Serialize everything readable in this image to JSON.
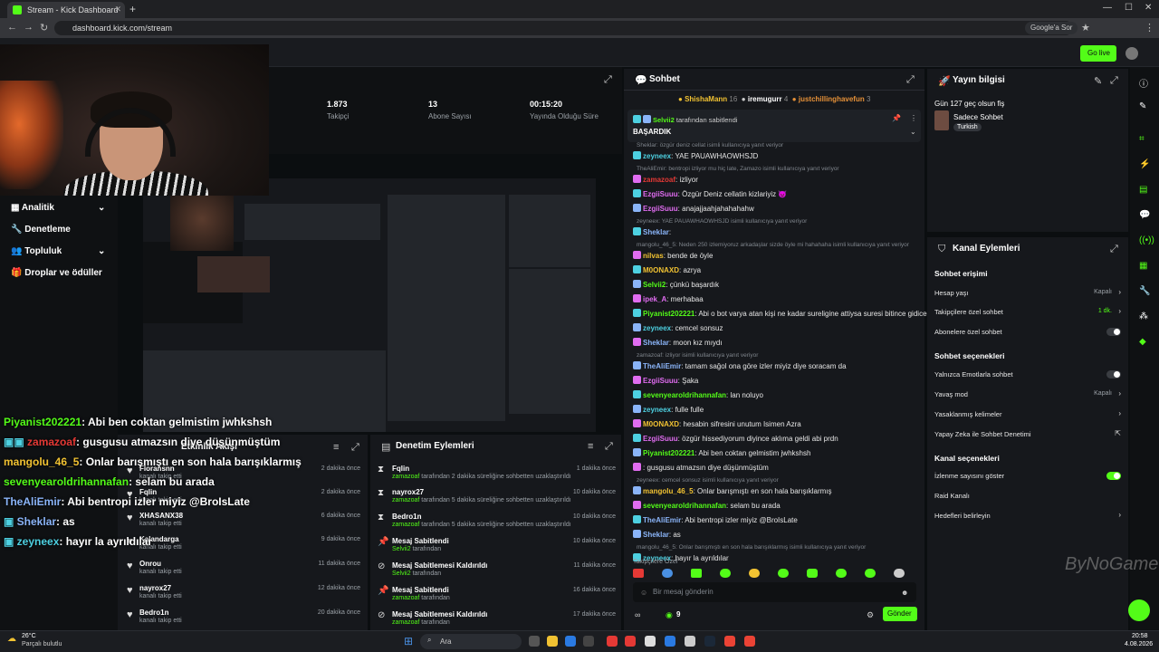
{
  "browser": {
    "tab_title": "Stream - Kick Dashboard",
    "url": "dashboard.kick.com/stream",
    "google_sor": "Google'a Sor"
  },
  "header": {
    "go_live": "Go live"
  },
  "sidebar": {
    "items": [
      {
        "label": "Analitik",
        "icon": "chart-icon"
      },
      {
        "label": "Denetleme",
        "icon": "wrench-icon"
      },
      {
        "label": "Topluluk",
        "icon": "users-icon"
      },
      {
        "label": "Droplar ve ödüller",
        "icon": "gift-icon"
      }
    ]
  },
  "stats": [
    {
      "value": "1.873",
      "label": "Takipçi"
    },
    {
      "value": "13",
      "label": "Abone Sayısı"
    },
    {
      "value": "00:15:20",
      "label": "Yayında Olduğu Süre"
    }
  ],
  "overlay_chat": [
    {
      "user": "Piyanist202221",
      "msg": ": Abi ben coktan gelmistim jwhkshsh",
      "color": "#53fc18"
    },
    {
      "user": "zamazoaf",
      "msg": ": gusgusu atmazsın diye düşünmüştüm",
      "color": "#e53935"
    },
    {
      "user": "mangolu_46_5",
      "msg": ": Onlar barışmıştı en son hala barışıklarmış",
      "color": "#f1c232"
    },
    {
      "user": "sevenyearoldrihannafan",
      "msg": ": selam bu arada",
      "color": "#53fc18"
    },
    {
      "user": "TheAliEmir",
      "msg": ": Abi bentropi izler miyiz @BroIsLate",
      "color": "#8ab4f8"
    },
    {
      "user": "Sheklar",
      "msg": ": as",
      "color": "#8ab4f8"
    },
    {
      "user": "zeyneex",
      "msg": ": hayır la ayrıldılar",
      "color": "#4dd0e1"
    }
  ],
  "followers": {
    "title": "Etkinlik Akışı",
    "items": [
      {
        "name": "Floransnn",
        "sub": "kanalı takip etti",
        "time": "2 dakika önce"
      },
      {
        "name": "Fqlin",
        "sub": "kanalı takip etti",
        "time": "2 dakika önce"
      },
      {
        "name": "XHASANX38",
        "sub": "kanalı takip etti",
        "time": "6 dakika önce"
      },
      {
        "name": "Kalandarga",
        "sub": "kanalı takip etti",
        "time": "9 dakika önce"
      },
      {
        "name": "Onrou",
        "sub": "kanalı takip etti",
        "time": "11 dakika önce"
      },
      {
        "name": "nayrox27",
        "sub": "kanalı takip etti",
        "time": "12 dakika önce"
      },
      {
        "name": "Bedro1n",
        "sub": "kanalı takip etti",
        "time": "20 dakika önce"
      }
    ]
  },
  "moderation": {
    "title": "Denetim Eylemleri",
    "items": [
      {
        "name": "Fqlin",
        "by": "zamazoaf",
        "sub": " tarafından 2 dakika süreliğine sohbetten uzaklaştırıldı",
        "time": "1 dakika önce",
        "icon": "hourglass-icon"
      },
      {
        "name": "nayrox27",
        "by": "zamazoaf",
        "sub": " tarafından 5 dakika süreliğine sohbetten uzaklaştırıldı",
        "time": "10 dakika önce",
        "icon": "hourglass-icon"
      },
      {
        "name": "Bedro1n",
        "by": "zamazoaf",
        "sub": " tarafından 5 dakika süreliğine sohbetten uzaklaştırıldı",
        "time": "10 dakika önce",
        "icon": "hourglass-icon"
      },
      {
        "name": "Mesaj Sabitlendi",
        "by": "Selvii2",
        "sub": " tarafından",
        "time": "10 dakika önce",
        "icon": "pin-icon"
      },
      {
        "name": "Mesaj Sabitlemesi Kaldırıldı",
        "by": "Selvii2",
        "sub": " tarafından",
        "time": "11 dakika önce",
        "icon": "unpin-icon"
      },
      {
        "name": "Mesaj Sabitlendi",
        "by": "zamazoaf",
        "sub": " tarafından",
        "time": "16 dakika önce",
        "icon": "pin-icon"
      },
      {
        "name": "Mesaj Sabitlemesi Kaldırıldı",
        "by": "zamazoaf",
        "sub": " tarafından",
        "time": "17 dakika önce",
        "icon": "unpin-icon"
      }
    ]
  },
  "chat": {
    "title": "Sohbet",
    "top_gifters": [
      {
        "name": "ShishaMann",
        "count": "16"
      },
      {
        "name": "iremugurr",
        "count": "4"
      },
      {
        "name": "justchillinghavefun",
        "count": "3"
      }
    ],
    "pinned_by": "Selvii2",
    "pinned_by_suffix": " tarafından sabitlendi",
    "pinned_msg": "BAŞARDIK",
    "messages": [
      {
        "reply": "Sheklar: özgür deniz cellat isimli kullanıcıya yanıt veriyor"
      },
      {
        "user": "zeyneex",
        "color": "#4dd0e1",
        "text": ": YAE PAUAWHAOWHSJD"
      },
      {
        "reply": "TheAliEmir: bentropi izliyor mu hiç late, Zamazo isimli kullanıcıya yanıt veriyor"
      },
      {
        "user": "zamazoaf",
        "color": "#e53935",
        "text": ": izliyor"
      },
      {
        "user": "EzgiiSuuu",
        "color": "#e06cf0",
        "text": ": Özgür Deniz cellatin kizlariyiz 😈"
      },
      {
        "user": "EzgiiSuuu",
        "color": "#e06cf0",
        "text": ": anajajjaahjahahahahw"
      },
      {
        "reply": "zeyneex: YAE PAUAWHAOWHSJD isimli kullanıcıya yanıt veriyor"
      },
      {
        "user": "Sheklar",
        "color": "#8ab4f8",
        "text": ":"
      },
      {
        "reply": "mangolu_46_5: Neden 250 izlemiyoruz arkadaşlar sizde öyle mi hahahaha isimli kullanıcıya yanıt veriyor"
      },
      {
        "user": "nilvas",
        "color": "#f1c232",
        "text": ": bende de öyle"
      },
      {
        "user": "M0ONAXD",
        "color": "#f1c232",
        "text": ": azrya"
      },
      {
        "user": "Selvii2",
        "color": "#53fc18",
        "text": ": çünkü başardık"
      },
      {
        "user": "ipek_A",
        "color": "#e06cf0",
        "text": ": merhabaa"
      },
      {
        "user": "Piyanist202221",
        "color": "#53fc18",
        "text": ": Abi o bot varya atan kişi ne kadar sureligine attiysa suresi bitince gidicekler"
      },
      {
        "user": "zeyneex",
        "color": "#4dd0e1",
        "text": ": cemcel sonsuz"
      },
      {
        "user": "Sheklar",
        "color": "#8ab4f8",
        "text": ": moon kız mıydı"
      },
      {
        "reply": "zamazoaf: izliyor isimli kullanıcıya yanıt veriyor"
      },
      {
        "user": "TheAliEmir",
        "color": "#8ab4f8",
        "text": ": tamam sağol ona göre izler miyiz diye soracam da"
      },
      {
        "user": "EzgiiSuuu",
        "color": "#e06cf0",
        "text": ": Şaka"
      },
      {
        "user": "sevenyearoldrihannafan",
        "color": "#53fc18",
        "text": ": lan noluyo"
      },
      {
        "user": "zeyneex",
        "color": "#4dd0e1",
        "text": ": fulle fulle"
      },
      {
        "user": "M0ONAXD",
        "color": "#f1c232",
        "text": ": hesabin sifresini unutum Isimen Azra"
      },
      {
        "user": "EzgiiSuuu",
        "color": "#e06cf0",
        "text": ": özgür hissediyorum diyince aklıma geldi abi prdn"
      },
      {
        "user": "Piyanist202221",
        "color": "#53fc18",
        "text": ": Abi ben coktan gelmistim jwhkshsh"
      },
      {
        "user": "",
        "color": "#e53935",
        "text": ": gusgusu atmazsın diye düşünmüştüm"
      },
      {
        "reply": "zeyneex: cemcel sonsuz isimli kullanıcıya yanıt veriyor"
      },
      {
        "user": "mangolu_46_5",
        "color": "#f1c232",
        "text": ": Onlar barışmıştı en son hala barışıklarmış"
      },
      {
        "user": "sevenyearoldrihannafan",
        "color": "#53fc18",
        "text": ": selam bu arada"
      },
      {
        "user": "TheAliEmir",
        "color": "#8ab4f8",
        "text": ": Abi bentropi izler miyiz @BroIsLate"
      },
      {
        "user": "Sheklar",
        "color": "#8ab4f8",
        "text": ": as"
      },
      {
        "reply": "mangolu_46_5: Onlar barışmıştı en son hala barışıklarmış isimli kullanıcıya yanıt veriyor"
      },
      {
        "user": "zeyneex",
        "color": "#4dd0e1",
        "text": ": hayır la ayrıldılar"
      }
    ],
    "followers_only": "Takipçilere Özel",
    "input_placeholder": "Bir mesaj gönderin",
    "points": "9",
    "send": "Gönder"
  },
  "stream_info": {
    "title": "Yayın bilgisi",
    "stream_title": "Gün 127 geç olsun fiş",
    "category": "Sadece Sohbet",
    "tag": "Turkish"
  },
  "channel_actions": {
    "title": "Kanal Eylemleri",
    "sections": [
      {
        "heading": "Sohbet erişimi",
        "rows": [
          {
            "label": "Hesap yaşı",
            "value": "Kapalı",
            "kind": "chevron"
          },
          {
            "label": "Takipçilere özel sohbet",
            "value": "1 dk.",
            "kind": "chevron"
          },
          {
            "label": "Abonelere özel sohbet",
            "value": "",
            "kind": "toggle-off"
          }
        ]
      },
      {
        "heading": "Sohbet seçenekleri",
        "rows": [
          {
            "label": "Yalnızca Emotlarla sohbet",
            "value": "",
            "kind": "toggle-off"
          },
          {
            "label": "Yavaş mod",
            "value": "Kapalı",
            "kind": "chevron"
          },
          {
            "label": "Yasaklanmış kelimeler",
            "value": "",
            "kind": "chevron"
          },
          {
            "label": "Yapay Zeka ile Sohbet Denetimi",
            "value": "",
            "kind": "external"
          }
        ]
      },
      {
        "heading": "Kanal seçenekleri",
        "rows": [
          {
            "label": "İzlenme sayısını göster",
            "value": "",
            "kind": "toggle-on"
          },
          {
            "label": "Raid Kanalı",
            "value": "",
            "kind": "none"
          },
          {
            "label": "Hedefleri belirleyin",
            "value": "",
            "kind": "chevron"
          }
        ]
      }
    ]
  },
  "watermark": "ByNoGame",
  "taskbar": {
    "weather_temp": "26°C",
    "weather_desc": "Parçalı bulutlu",
    "search": "Ara",
    "time": "20:58",
    "date": "4.08.2026"
  },
  "colors": {
    "accent": "#53fc18",
    "panel": "#16181c",
    "bg": "#0b0e10"
  }
}
